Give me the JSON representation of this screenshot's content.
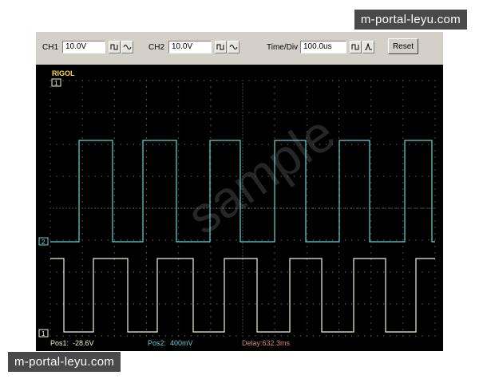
{
  "toolbar": {
    "ch1_label": "CH1",
    "ch1_value": "10.0V",
    "ch2_label": "CH2",
    "ch2_value": "10.0V",
    "timediv_label": "Time/Div",
    "timediv_value": "100.0us",
    "reset_label": "Reset"
  },
  "screen": {
    "brand": "RIGOL",
    "ch1_marker": "1",
    "ch2_marker": "2",
    "pos1": "Pos1:  -28.6V",
    "pos2": "Pos2:  400mV",
    "delay": "Delay:632.3ms",
    "watermark": "sample"
  },
  "watermarks": {
    "top": "m-portal-leyu.com",
    "bottom": "m-portal-leyu.com"
  },
  "colors": {
    "ch1_trace": "#f2f2d0",
    "ch2_trace": "#6ad4d0",
    "grid": "#9a9a9a",
    "brand": "#ffd84a",
    "pos1": "#f5f5c8",
    "pos2": "#5fd2d0",
    "delay": "#d08a6a"
  }
}
